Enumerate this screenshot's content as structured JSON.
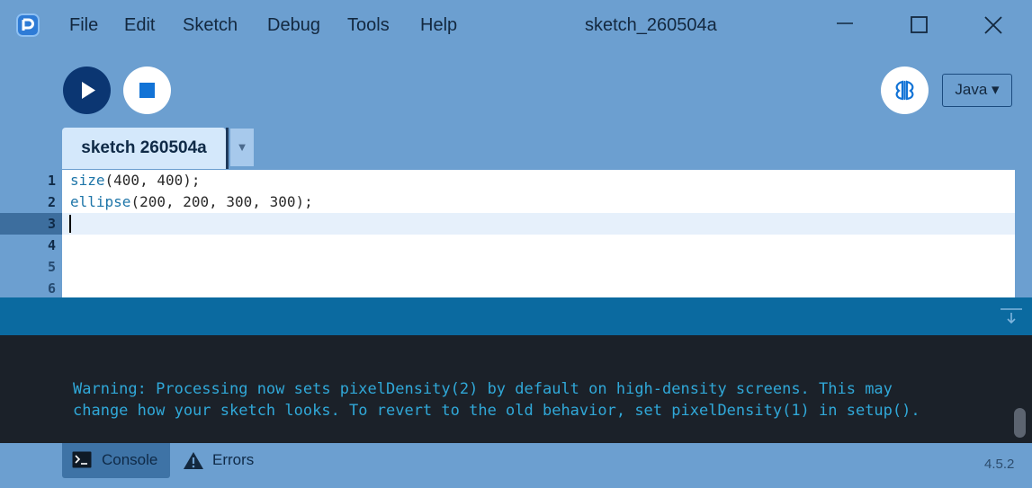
{
  "titlebar": {
    "menu": [
      "File",
      "Edit",
      "Sketch",
      "Debug",
      "Tools",
      "Help"
    ],
    "title": "sketch_260504a",
    "icons": [
      "processing-logo-icon",
      "minimize-icon",
      "maximize-icon",
      "close-icon"
    ]
  },
  "toolbar": {
    "run_icon": "play-icon",
    "stop_icon": "stop-icon",
    "debug_icon": "butterfly-icon",
    "mode": "Java ▾"
  },
  "tabs": {
    "active": "sketch 260504a",
    "menu_arrow": "▼"
  },
  "editor": {
    "line_numbers": [
      "1",
      "2",
      "3",
      "4",
      "5",
      "6"
    ],
    "lines": [
      {
        "fn": "size",
        "args": "(400, 400);"
      },
      {
        "fn": "ellipse",
        "args": "(200, 200, 300, 300);"
      },
      {
        "fn": "",
        "args": ""
      }
    ],
    "current_line": "3"
  },
  "console": {
    "lines": [
      "Warning: Processing now sets pixelDensity(2) by default on high-density screens. This may",
      "change how your sketch looks. To revert to the old behavior, set pixelDensity(1) in setup()."
    ]
  },
  "footer": {
    "console_tab": "Console",
    "errors_tab": "Errors",
    "version": "4.5.2"
  },
  "colors": {
    "frame": "#6c9fd0",
    "run_button": "#0b3672",
    "console_header": "#0b6aa0",
    "console_bg": "#1b2129",
    "console_text": "#30a8d8",
    "keyword": "#1e75a8"
  }
}
